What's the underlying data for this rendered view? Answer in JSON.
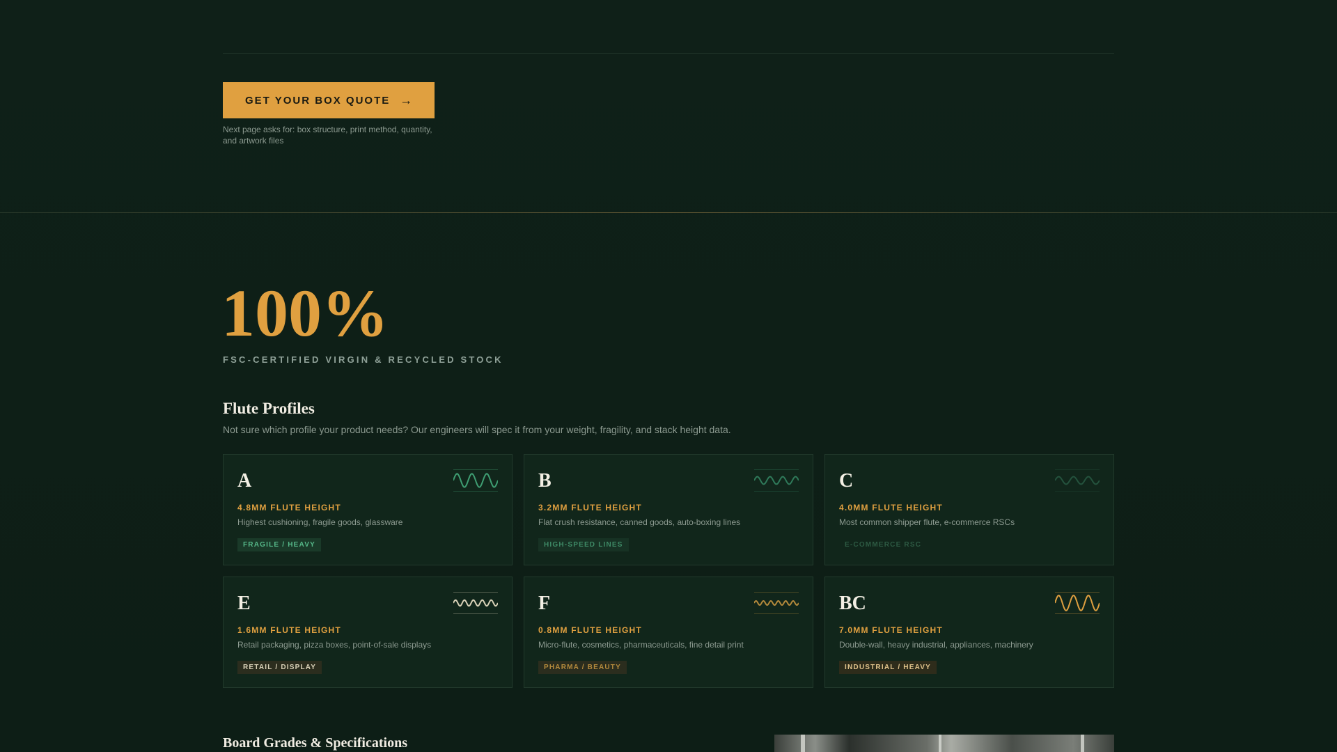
{
  "cta": {
    "label": "GET YOUR BOX QUOTE",
    "arrow_icon": "→",
    "note": "Next page asks for: box structure, print method, quantity, and artwork files"
  },
  "stat": {
    "value": "100%",
    "label": "FSC-CERTIFIED VIRGIN & RECYCLED STOCK"
  },
  "flute_section": {
    "title": "Flute Profiles",
    "subtitle": "Not sure which profile your product needs? Our engineers will spec it from your weight, fragility, and stack height data."
  },
  "flutes": [
    {
      "letter": "A",
      "spec": "4.8MM FLUTE HEIGHT",
      "desc": "Highest cushioning, fragile goods, glassware",
      "tag": "FRAGILE / HEAVY",
      "tag_style": "tag-green",
      "wave_color": "#3f9e73",
      "wave_periods": 3,
      "wave_amplitude": 0.8,
      "wave_opacity": 1
    },
    {
      "letter": "B",
      "spec": "3.2MM FLUTE HEIGHT",
      "desc": "Flat crush resistance, canned goods, auto-boxing lines",
      "tag": "HIGH-SPEED LINES",
      "tag_style": "tag-green-dim",
      "wave_color": "#2f7a5a",
      "wave_periods": 3.5,
      "wave_amplitude": 0.45,
      "wave_opacity": 1
    },
    {
      "letter": "C",
      "spec": "4.0MM FLUTE HEIGHT",
      "desc": "Most common shipper flute, e-commerce RSCs",
      "tag": "E-COMMERCE RSC",
      "tag_style": "tag-faint",
      "wave_color": "#24523d",
      "wave_periods": 3,
      "wave_amplitude": 0.45,
      "wave_opacity": 1
    },
    {
      "letter": "E",
      "spec": "1.6MM FLUTE HEIGHT",
      "desc": "Retail packaging, pizza boxes, point-of-sale displays",
      "tag": "RETAIL / DISPLAY",
      "tag_style": "tag-olive",
      "wave_color": "#d9d2b8",
      "wave_periods": 5,
      "wave_amplitude": 0.35,
      "wave_opacity": 1
    },
    {
      "letter": "F",
      "spec": "0.8MM FLUTE HEIGHT",
      "desc": "Micro-flute, cosmetics, pharmaceuticals, fine detail print",
      "tag": "PHARMA / BEAUTY",
      "tag_style": "tag-gold-dim",
      "wave_color": "#b48a3c",
      "wave_periods": 6,
      "wave_amplitude": 0.25,
      "wave_opacity": 1
    },
    {
      "letter": "BC",
      "spec": "7.0MM FLUTE HEIGHT",
      "desc": "Double-wall, heavy industrial, appliances, machinery",
      "tag": "INDUSTRIAL / HEAVY",
      "tag_style": "tag-gold",
      "wave_color": "#e0a040",
      "wave_periods": 3,
      "wave_amplitude": 0.9,
      "wave_opacity": 1
    }
  ],
  "board_section": {
    "title": "Board Grades & Specifications"
  }
}
